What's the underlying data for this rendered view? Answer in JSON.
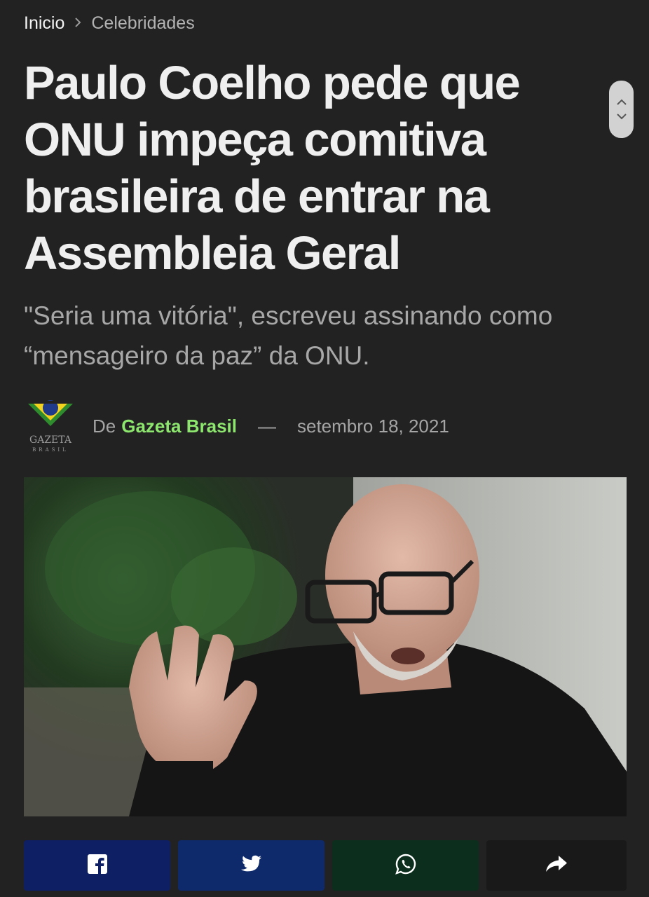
{
  "breadcrumb": {
    "home": "Inicio",
    "separator_icon": "chevron-right-icon",
    "current": "Celebridades"
  },
  "article": {
    "title": "Paulo Coelho pede que ONU impeça comitiva brasileira de entrar na Assembleia Geral",
    "subtitle": "\"Seria uma vitória\", escreveu assinando como “mensageiro da paz” da ONU.",
    "byline": {
      "prefix": "De",
      "author": "Gazeta Brasil",
      "separator": "—",
      "date": "setembro 18, 2021"
    },
    "logo_text": {
      "line1": "GAZETA",
      "line2": "BRASIL"
    }
  },
  "share": [
    {
      "name": "facebook",
      "icon": "facebook-icon",
      "color": "#0e1f63"
    },
    {
      "name": "twitter",
      "icon": "twitter-icon",
      "color": "#0e2a6b"
    },
    {
      "name": "whatsapp",
      "icon": "whatsapp-icon",
      "color": "#0c2e1c"
    },
    {
      "name": "share",
      "icon": "share-arrow-icon",
      "color": "#191919"
    }
  ],
  "colors": {
    "background": "#222222",
    "author_accent": "#8de66e",
    "subtitle": "#a7a7a7"
  }
}
